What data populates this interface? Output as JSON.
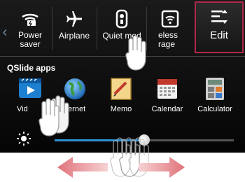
{
  "quick_settings": {
    "items": [
      {
        "label": "Power\nsaver",
        "icon": "power-saver-icon"
      },
      {
        "label": "Airplane",
        "icon": "airplane-icon"
      },
      {
        "label": "Quiet mod",
        "icon": "quiet-mode-icon"
      },
      {
        "label": "eless\nrage",
        "icon": "wireless-storage-icon"
      }
    ],
    "edit_label": "Edit"
  },
  "qslide": {
    "title": "QSlide apps",
    "apps": [
      {
        "label": "Vid",
        "icon": "video-icon"
      },
      {
        "label": "ternet",
        "icon": "internet-icon"
      },
      {
        "label": "Memo",
        "icon": "memo-icon"
      },
      {
        "label": "Calendar",
        "icon": "calendar-icon"
      },
      {
        "label": "Calculator",
        "icon": "calculator-icon"
      }
    ]
  },
  "brightness": {
    "level": 0.5,
    "icon": "brightness-icon"
  },
  "colors": {
    "accent": "#2b92d6",
    "highlight": "#b0294a",
    "arrow": "#e0737a"
  }
}
